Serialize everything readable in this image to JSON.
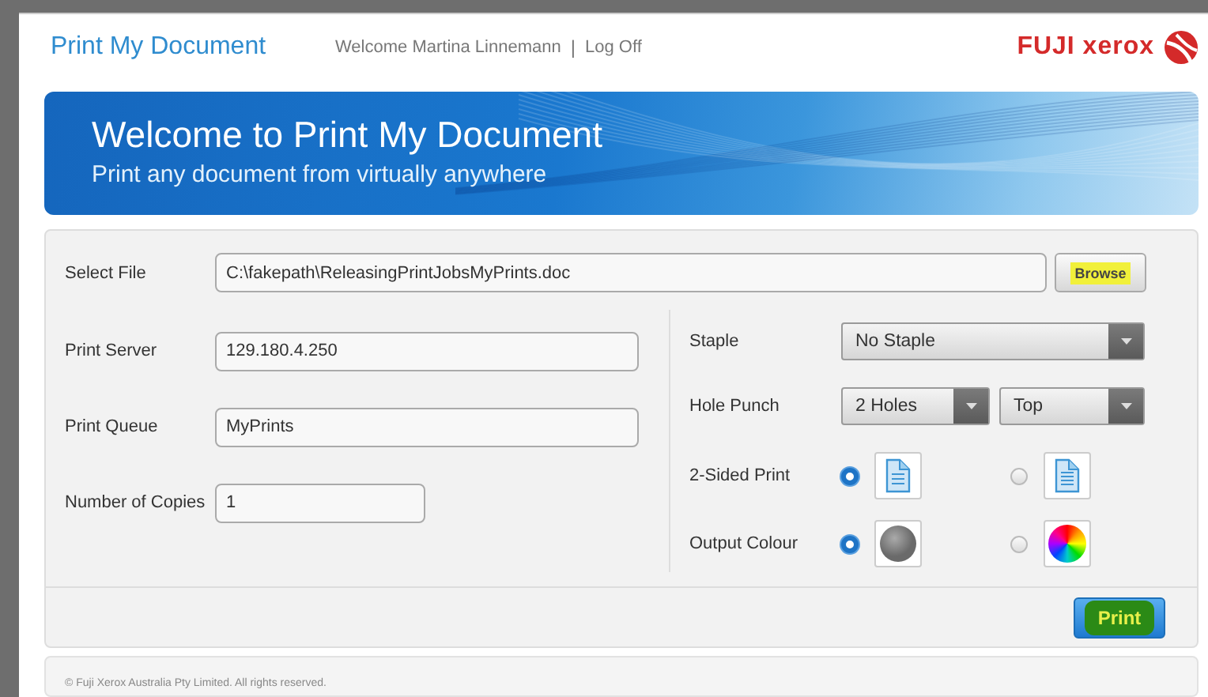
{
  "header": {
    "title": "Print My Document",
    "welcome": "Welcome Martina Linnemann",
    "separator": "|",
    "logoff": "Log Off",
    "logo": "FUJI xerox"
  },
  "banner": {
    "title": "Welcome to Print My Document",
    "subtitle": "Print any document from virtually anywhere"
  },
  "form": {
    "select_file": {
      "label": "Select File",
      "value": "C:\\fakepath\\ReleasingPrintJobsMyPrints.doc",
      "button": "Browse"
    },
    "fields": [
      {
        "kind": "text",
        "label": "Print Server",
        "value": "129.180.4.250"
      },
      {
        "kind": "text",
        "label": "Print Queue",
        "value": "MyPrints"
      },
      {
        "kind": "number",
        "label": "Number of Copies",
        "value": "1"
      }
    ],
    "staple": {
      "label": "Staple",
      "value": "No Staple"
    },
    "hole_punch": {
      "label": "Hole Punch",
      "holes": "2 Holes",
      "position": "Top"
    },
    "two_sided": {
      "label": "2-Sided Print",
      "options": [
        {
          "kind": "long-edge",
          "selected": true
        },
        {
          "kind": "short-edge",
          "selected": false
        }
      ]
    },
    "output_colour": {
      "label": "Output Colour",
      "options": [
        {
          "kind": "grayscale",
          "selected": true
        },
        {
          "kind": "color",
          "selected": false
        }
      ]
    },
    "print_button": "Print"
  },
  "footer": {
    "copyright": "© Fuji Xerox Australia Pty Limited. All rights reserved."
  }
}
